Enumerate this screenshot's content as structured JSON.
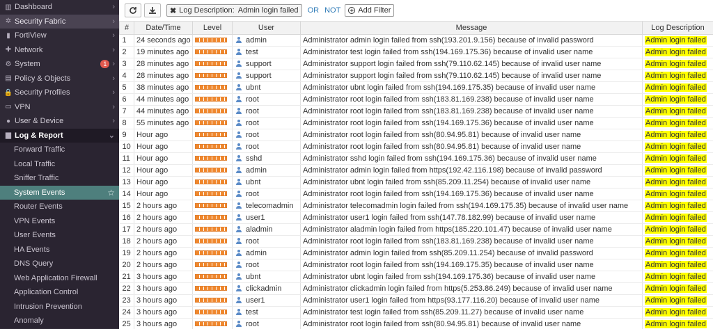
{
  "sidebar": {
    "items": [
      {
        "label": "Dashboard",
        "icon": "dashboard-icon",
        "glyph": "▥"
      },
      {
        "label": "Security Fabric",
        "icon": "fabric-icon",
        "glyph": "✲"
      },
      {
        "label": "FortiView",
        "icon": "chart-icon",
        "glyph": "▮"
      },
      {
        "label": "Network",
        "icon": "network-icon",
        "glyph": "✚"
      },
      {
        "label": "System",
        "icon": "gear-icon",
        "glyph": "⚙",
        "badge": "1"
      },
      {
        "label": "Policy & Objects",
        "icon": "document-icon",
        "glyph": "▤"
      },
      {
        "label": "Security Profiles",
        "icon": "lock-icon",
        "glyph": "🔒"
      },
      {
        "label": "VPN",
        "icon": "monitor-icon",
        "glyph": "▭"
      },
      {
        "label": "User & Device",
        "icon": "user-icon",
        "glyph": "●"
      },
      {
        "label": "Log & Report",
        "icon": "bar-chart-icon",
        "glyph": "▆"
      }
    ],
    "subitems": [
      "Forward Traffic",
      "Local Traffic",
      "Sniffer Traffic",
      "System Events",
      "Router Events",
      "VPN Events",
      "User Events",
      "HA Events",
      "DNS Query",
      "Web Application Firewall",
      "Application Control",
      "Intrusion Prevention",
      "Anomaly"
    ]
  },
  "toolbar": {
    "filter_key": "Log Description:",
    "filter_value": "Admin login failed",
    "or_label": "OR",
    "not_label": "NOT",
    "add_filter_label": "Add Filter"
  },
  "table": {
    "headers": [
      "#",
      "Date/Time",
      "Level",
      "User",
      "Message",
      "Log Description"
    ],
    "rows": [
      [
        "1",
        "24 seconds ago",
        "admin",
        "Administrator admin login failed from ssh(193.201.9.156) because of invalid password",
        "Admin login failed"
      ],
      [
        "2",
        "19 minutes ago",
        "test",
        "Administrator test login failed from ssh(194.169.175.36) because of invalid user name",
        "Admin login failed"
      ],
      [
        "3",
        "28 minutes ago",
        "support",
        "Administrator support login failed from ssh(79.110.62.145) because of invalid user name",
        "Admin login failed"
      ],
      [
        "4",
        "28 minutes ago",
        "support",
        "Administrator support login failed from ssh(79.110.62.145) because of invalid user name",
        "Admin login failed"
      ],
      [
        "5",
        "38 minutes ago",
        "ubnt",
        "Administrator ubnt login failed from ssh(194.169.175.35) because of invalid user name",
        "Admin login failed"
      ],
      [
        "6",
        "44 minutes ago",
        "root",
        "Administrator root login failed from ssh(183.81.169.238) because of invalid user name",
        "Admin login failed"
      ],
      [
        "7",
        "44 minutes ago",
        "root",
        "Administrator root login failed from ssh(183.81.169.238) because of invalid user name",
        "Admin login failed"
      ],
      [
        "8",
        "55 minutes ago",
        "root",
        "Administrator root login failed from ssh(194.169.175.36) because of invalid user name",
        "Admin login failed"
      ],
      [
        "9",
        "Hour ago",
        "root",
        "Administrator root login failed from ssh(80.94.95.81) because of invalid user name",
        "Admin login failed"
      ],
      [
        "10",
        "Hour ago",
        "root",
        "Administrator root login failed from ssh(80.94.95.81) because of invalid user name",
        "Admin login failed"
      ],
      [
        "11",
        "Hour ago",
        "sshd",
        "Administrator sshd login failed from ssh(194.169.175.36) because of invalid user name",
        "Admin login failed"
      ],
      [
        "12",
        "Hour ago",
        "admin",
        "Administrator admin login failed from https(192.42.116.198) because of invalid password",
        "Admin login failed"
      ],
      [
        "13",
        "Hour ago",
        "ubnt",
        "Administrator ubnt login failed from ssh(85.209.11.254) because of invalid user name",
        "Admin login failed"
      ],
      [
        "14",
        "Hour ago",
        "root",
        "Administrator root login failed from ssh(194.169.175.36) because of invalid user name",
        "Admin login failed"
      ],
      [
        "15",
        "2 hours ago",
        "telecomadmin",
        "Administrator telecomadmin login failed from ssh(194.169.175.35) because of invalid user name",
        "Admin login failed"
      ],
      [
        "16",
        "2 hours ago",
        "user1",
        "Administrator user1 login failed from ssh(147.78.182.99) because of invalid user name",
        "Admin login failed"
      ],
      [
        "17",
        "2 hours ago",
        "aladmin",
        "Administrator aladmin login failed from https(185.220.101.47) because of invalid user name",
        "Admin login failed"
      ],
      [
        "18",
        "2 hours ago",
        "root",
        "Administrator root login failed from ssh(183.81.169.238) because of invalid user name",
        "Admin login failed"
      ],
      [
        "19",
        "2 hours ago",
        "admin",
        "Administrator admin login failed from ssh(85.209.11.254) because of invalid password",
        "Admin login failed"
      ],
      [
        "20",
        "2 hours ago",
        "root",
        "Administrator root login failed from ssh(194.169.175.35) because of invalid user name",
        "Admin login failed"
      ],
      [
        "21",
        "3 hours ago",
        "ubnt",
        "Administrator ubnt login failed from ssh(194.169.175.36) because of invalid user name",
        "Admin login failed"
      ],
      [
        "22",
        "3 hours ago",
        "clickadmin",
        "Administrator clickadmin login failed from https(5.253.86.249) because of invalid user name",
        "Admin login failed"
      ],
      [
        "23",
        "3 hours ago",
        "user1",
        "Administrator user1 login failed from https(93.177.116.20) because of invalid user name",
        "Admin login failed"
      ],
      [
        "24",
        "3 hours ago",
        "test",
        "Administrator test login failed from ssh(85.209.11.27) because of invalid user name",
        "Admin login failed"
      ],
      [
        "25",
        "3 hours ago",
        "root",
        "Administrator root login failed from ssh(80.94.95.81) because of invalid user name",
        "Admin login failed"
      ]
    ]
  },
  "colors": {
    "sidebar_bg": "#2f2936",
    "active_item": "#4e7f7d",
    "level_bar": "#f0882e",
    "highlight": "#ffff00"
  }
}
